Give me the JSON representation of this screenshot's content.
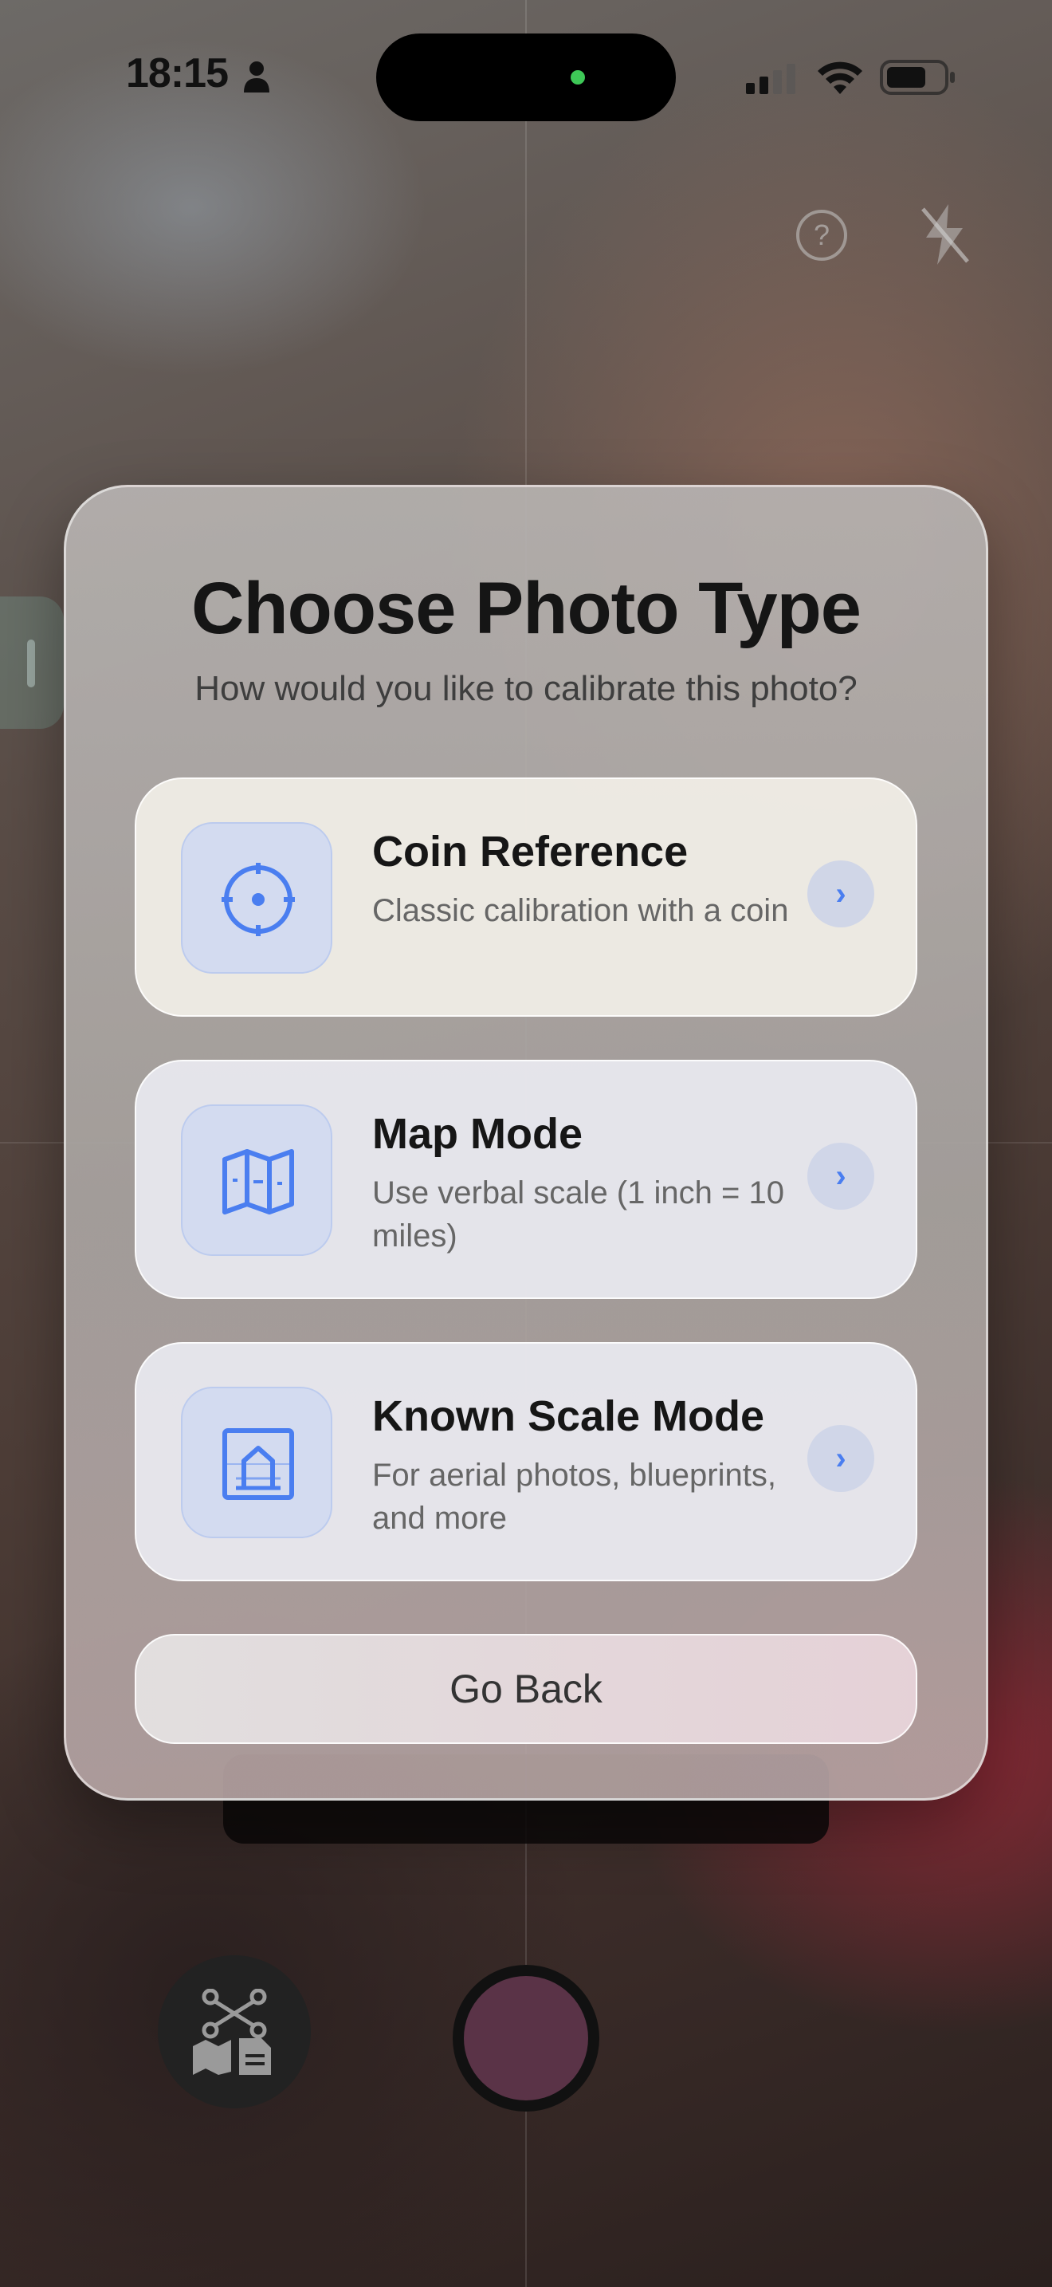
{
  "status_bar": {
    "time": "18:15"
  },
  "modal": {
    "title": "Choose Photo Type",
    "subtitle": "How would you like to calibrate this photo?",
    "options": [
      {
        "title": "Coin Reference",
        "description": "Classic calibration with a coin",
        "icon": "coin-target-icon"
      },
      {
        "title": "Map Mode",
        "description": "Use verbal scale (1 inch = 10 miles)",
        "icon": "map-icon"
      },
      {
        "title": "Known Scale Mode",
        "description": "For aerial photos, blueprints, and more",
        "icon": "blueprint-icon"
      }
    ],
    "go_back_label": "Go Back"
  },
  "colors": {
    "accent": "#4A7EF0",
    "icon_tile": "#D3DBF0",
    "shutter_inner": "#5A3347",
    "cam_indicator": "#3EC857"
  }
}
